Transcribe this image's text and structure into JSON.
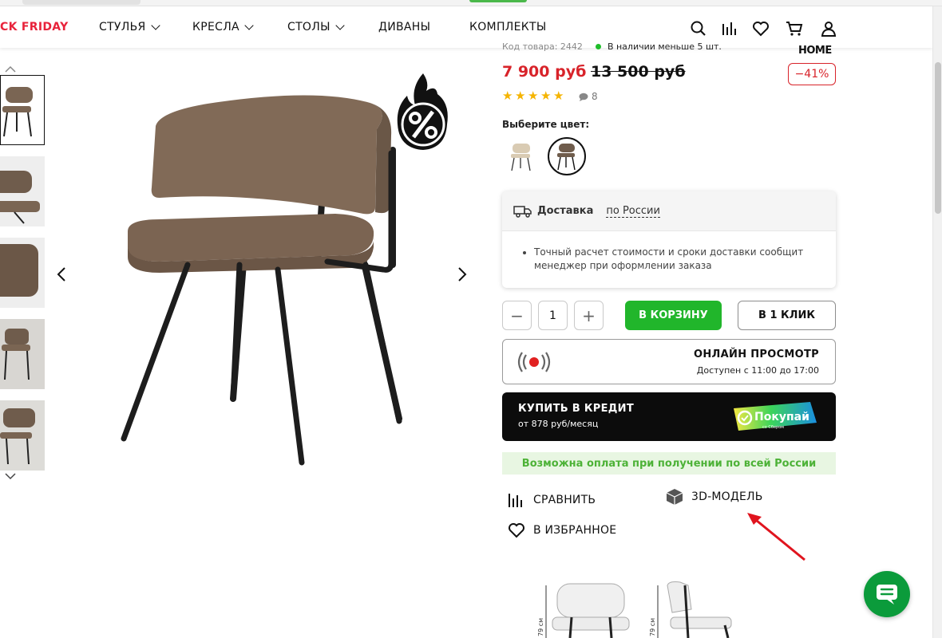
{
  "nav": {
    "items": [
      {
        "label": "CK FRIDAY"
      },
      {
        "label": "СТУЛЬЯ"
      },
      {
        "label": "КРЕСЛА"
      },
      {
        "label": "СТОЛЫ"
      },
      {
        "label": "ДИВАНЫ"
      },
      {
        "label": "КОМПЛЕКТЫ"
      }
    ],
    "icons": [
      "search-icon",
      "compare-icon",
      "heart-icon",
      "cart-icon",
      "user-icon"
    ]
  },
  "product": {
    "code_label": "Код товара: 2442",
    "stock": "В наличии меньше 5 шт.",
    "brand": "HOME",
    "price": "7 900 руб",
    "old_price": "13 500 руб",
    "discount": "−41%",
    "rating": 5,
    "reviews": "8",
    "color_label": "Выберите цвет:"
  },
  "delivery": {
    "title": "Доставка",
    "link": "по России",
    "note": "Точный расчет стоимости и сроки доставки сообщит менеджер при оформлении заказа"
  },
  "buy": {
    "minus": "−",
    "qty": "1",
    "plus": "+",
    "cart": "В КОРЗИНУ",
    "one_click": "В 1 КЛИК"
  },
  "online": {
    "title": "ОНЛАЙН ПРОСМОТР",
    "subtitle": "Доступен с 11:00 до 17:00"
  },
  "credit": {
    "title": "КУПИТЬ В КРЕДИТ",
    "subtitle": "от 878 руб/месяц",
    "badge": "Покупай",
    "badge_sub": "со Сбером"
  },
  "cod": "Возможна оплата при получении по всей России",
  "actions": {
    "compare": "СРАВНИТЬ",
    "model3d": "3D-МОДЕЛЬ",
    "favorite": "В ИЗБРАННОЕ"
  },
  "colors": {
    "accent_red": "#d8232a",
    "green": "#21b62b",
    "chat_green": "#0b9b3b"
  }
}
